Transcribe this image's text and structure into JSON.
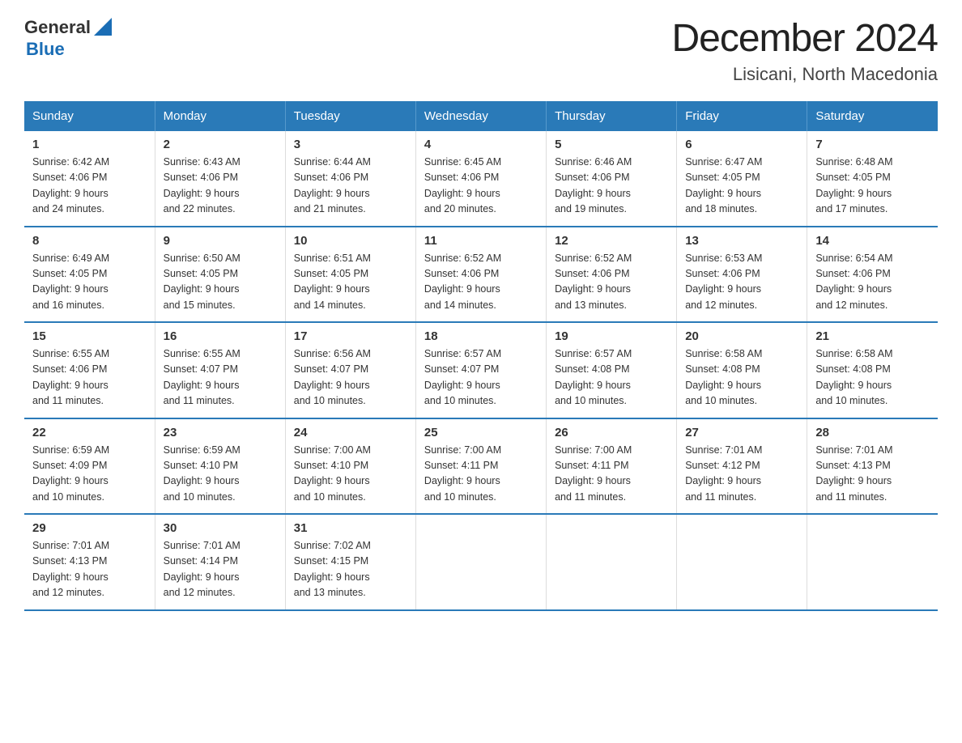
{
  "header": {
    "logo_general": "General",
    "logo_blue": "Blue",
    "month": "December 2024",
    "location": "Lisicani, North Macedonia"
  },
  "weekdays": [
    "Sunday",
    "Monday",
    "Tuesday",
    "Wednesday",
    "Thursday",
    "Friday",
    "Saturday"
  ],
  "weeks": [
    [
      {
        "day": "1",
        "sunrise": "6:42 AM",
        "sunset": "4:06 PM",
        "daylight": "9 hours and 24 minutes."
      },
      {
        "day": "2",
        "sunrise": "6:43 AM",
        "sunset": "4:06 PM",
        "daylight": "9 hours and 22 minutes."
      },
      {
        "day": "3",
        "sunrise": "6:44 AM",
        "sunset": "4:06 PM",
        "daylight": "9 hours and 21 minutes."
      },
      {
        "day": "4",
        "sunrise": "6:45 AM",
        "sunset": "4:06 PM",
        "daylight": "9 hours and 20 minutes."
      },
      {
        "day": "5",
        "sunrise": "6:46 AM",
        "sunset": "4:06 PM",
        "daylight": "9 hours and 19 minutes."
      },
      {
        "day": "6",
        "sunrise": "6:47 AM",
        "sunset": "4:05 PM",
        "daylight": "9 hours and 18 minutes."
      },
      {
        "day": "7",
        "sunrise": "6:48 AM",
        "sunset": "4:05 PM",
        "daylight": "9 hours and 17 minutes."
      }
    ],
    [
      {
        "day": "8",
        "sunrise": "6:49 AM",
        "sunset": "4:05 PM",
        "daylight": "9 hours and 16 minutes."
      },
      {
        "day": "9",
        "sunrise": "6:50 AM",
        "sunset": "4:05 PM",
        "daylight": "9 hours and 15 minutes."
      },
      {
        "day": "10",
        "sunrise": "6:51 AM",
        "sunset": "4:05 PM",
        "daylight": "9 hours and 14 minutes."
      },
      {
        "day": "11",
        "sunrise": "6:52 AM",
        "sunset": "4:06 PM",
        "daylight": "9 hours and 14 minutes."
      },
      {
        "day": "12",
        "sunrise": "6:52 AM",
        "sunset": "4:06 PM",
        "daylight": "9 hours and 13 minutes."
      },
      {
        "day": "13",
        "sunrise": "6:53 AM",
        "sunset": "4:06 PM",
        "daylight": "9 hours and 12 minutes."
      },
      {
        "day": "14",
        "sunrise": "6:54 AM",
        "sunset": "4:06 PM",
        "daylight": "9 hours and 12 minutes."
      }
    ],
    [
      {
        "day": "15",
        "sunrise": "6:55 AM",
        "sunset": "4:06 PM",
        "daylight": "9 hours and 11 minutes."
      },
      {
        "day": "16",
        "sunrise": "6:55 AM",
        "sunset": "4:07 PM",
        "daylight": "9 hours and 11 minutes."
      },
      {
        "day": "17",
        "sunrise": "6:56 AM",
        "sunset": "4:07 PM",
        "daylight": "9 hours and 10 minutes."
      },
      {
        "day": "18",
        "sunrise": "6:57 AM",
        "sunset": "4:07 PM",
        "daylight": "9 hours and 10 minutes."
      },
      {
        "day": "19",
        "sunrise": "6:57 AM",
        "sunset": "4:08 PM",
        "daylight": "9 hours and 10 minutes."
      },
      {
        "day": "20",
        "sunrise": "6:58 AM",
        "sunset": "4:08 PM",
        "daylight": "9 hours and 10 minutes."
      },
      {
        "day": "21",
        "sunrise": "6:58 AM",
        "sunset": "4:08 PM",
        "daylight": "9 hours and 10 minutes."
      }
    ],
    [
      {
        "day": "22",
        "sunrise": "6:59 AM",
        "sunset": "4:09 PM",
        "daylight": "9 hours and 10 minutes."
      },
      {
        "day": "23",
        "sunrise": "6:59 AM",
        "sunset": "4:10 PM",
        "daylight": "9 hours and 10 minutes."
      },
      {
        "day": "24",
        "sunrise": "7:00 AM",
        "sunset": "4:10 PM",
        "daylight": "9 hours and 10 minutes."
      },
      {
        "day": "25",
        "sunrise": "7:00 AM",
        "sunset": "4:11 PM",
        "daylight": "9 hours and 10 minutes."
      },
      {
        "day": "26",
        "sunrise": "7:00 AM",
        "sunset": "4:11 PM",
        "daylight": "9 hours and 11 minutes."
      },
      {
        "day": "27",
        "sunrise": "7:01 AM",
        "sunset": "4:12 PM",
        "daylight": "9 hours and 11 minutes."
      },
      {
        "day": "28",
        "sunrise": "7:01 AM",
        "sunset": "4:13 PM",
        "daylight": "9 hours and 11 minutes."
      }
    ],
    [
      {
        "day": "29",
        "sunrise": "7:01 AM",
        "sunset": "4:13 PM",
        "daylight": "9 hours and 12 minutes."
      },
      {
        "day": "30",
        "sunrise": "7:01 AM",
        "sunset": "4:14 PM",
        "daylight": "9 hours and 12 minutes."
      },
      {
        "day": "31",
        "sunrise": "7:02 AM",
        "sunset": "4:15 PM",
        "daylight": "9 hours and 13 minutes."
      },
      null,
      null,
      null,
      null
    ]
  ],
  "labels": {
    "sunrise": "Sunrise:",
    "sunset": "Sunset:",
    "daylight": "Daylight:"
  }
}
